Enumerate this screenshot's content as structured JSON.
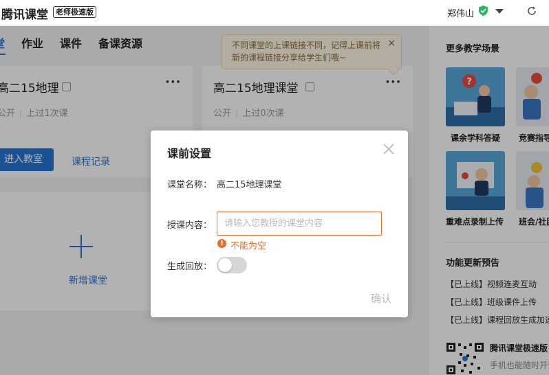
{
  "app": {
    "title": "腾讯课堂",
    "edition": "老师极速版",
    "user_name": "郑伟山"
  },
  "colors": {
    "accent": "#2a76d2",
    "warning": "#e2702f",
    "verified": "#2fb36b"
  },
  "tabs": [
    {
      "label": "堂"
    },
    {
      "label": "作业"
    },
    {
      "label": "课件"
    },
    {
      "label": "备课资源"
    }
  ],
  "tooltip": {
    "text": "不同课堂的上课链接不同，记得上课前将新的课程链接分享给学生们哦~",
    "close": "×"
  },
  "cards": [
    {
      "title": "高二15地理",
      "more": "···",
      "visibility": "公开",
      "taught": "上过1次课",
      "enter_button": "进入教室",
      "record_link": "课程记录"
    },
    {
      "title": "高二15地理课堂",
      "more": "···",
      "visibility": "公开",
      "taught": "上过0次课"
    }
  ],
  "new_class": {
    "label": "新增课堂"
  },
  "sidebar": {
    "scenes_heading": "更多教学场景",
    "scenes": [
      {
        "label": "课余学科答疑"
      },
      {
        "label": "竞赛指导"
      },
      {
        "label": "重难点录制上传"
      },
      {
        "label": "班会/社团"
      }
    ],
    "updates_heading": "功能更新预告",
    "updates": [
      {
        "text": "【已上线】视频连麦互动"
      },
      {
        "text": "【已上线】班级课件上传"
      },
      {
        "text": "【已上线】课程回放生成加速"
      }
    ],
    "qr_title": "腾讯课堂极速版",
    "qr_subtitle": "手机也能随时开课"
  },
  "modal": {
    "title": "课前设置",
    "class_name_label": "课堂名称：",
    "class_name_value": "高二15地理课堂",
    "content_label": "授课内容：",
    "content_placeholder": "请输入您教授的课堂内容",
    "content_value": "",
    "error_text": "不能为空",
    "replay_label": "生成回放：",
    "replay_enabled": false,
    "confirm_label": "确认"
  }
}
